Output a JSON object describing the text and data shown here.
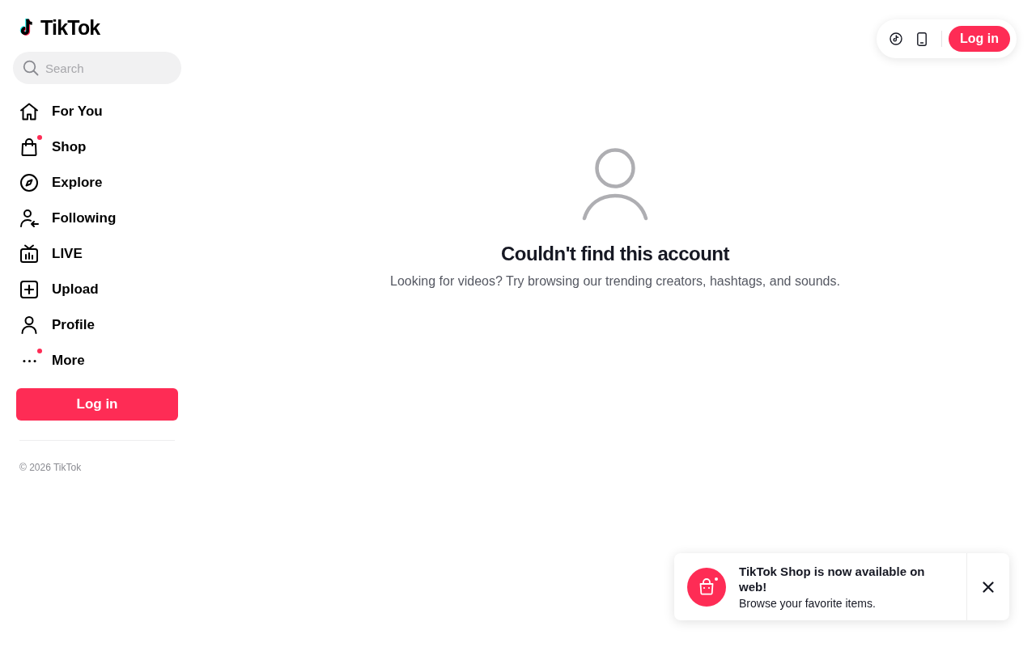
{
  "logo": {
    "text": "TikTok"
  },
  "search": {
    "placeholder": "Search"
  },
  "nav": [
    {
      "kind": "home",
      "label": "For You",
      "dot": false
    },
    {
      "kind": "shop",
      "label": "Shop",
      "dot": true
    },
    {
      "kind": "explore",
      "label": "Explore",
      "dot": false
    },
    {
      "kind": "following",
      "label": "Following",
      "dot": false
    },
    {
      "kind": "live",
      "label": "LIVE",
      "dot": false
    },
    {
      "kind": "upload",
      "label": "Upload",
      "dot": false
    },
    {
      "kind": "profile",
      "label": "Profile",
      "dot": false
    },
    {
      "kind": "more",
      "label": "More",
      "dot": true
    }
  ],
  "sidebar_login": {
    "label": "Log in"
  },
  "footer": {
    "copyright": "© 2026 TikTok"
  },
  "top_bar": {
    "login": {
      "label": "Log in"
    }
  },
  "empty_state": {
    "title": "Couldn't find this account",
    "message": "Looking for videos? Try browsing our trending creators, hashtags, and sounds."
  },
  "toast": {
    "title": "TikTok Shop is now available on web!",
    "message": "Browse your favorite items."
  }
}
